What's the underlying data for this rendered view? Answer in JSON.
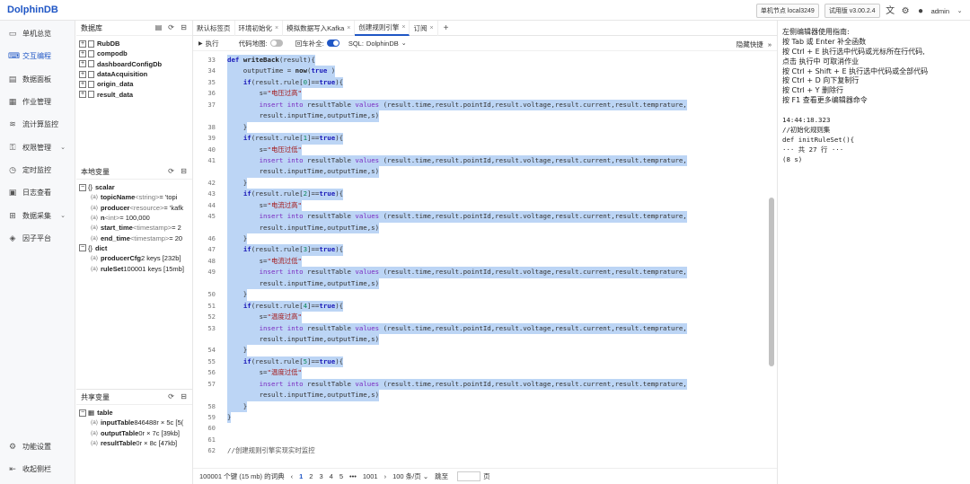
{
  "app": {
    "logo": "DolphinDB",
    "node": "单机节点 local3249",
    "version": "试用版 v3.00.2.4",
    "user": "admin"
  },
  "nav": {
    "items": [
      {
        "label": "单机总览",
        "icon": "laptop-icon"
      },
      {
        "label": "交互编程",
        "icon": "code-icon",
        "active": true
      },
      {
        "label": "数据面板",
        "icon": "dashboard-icon"
      },
      {
        "label": "作业管理",
        "icon": "job-icon"
      },
      {
        "label": "流计算监控",
        "icon": "stream-icon"
      },
      {
        "label": "权限管理",
        "icon": "lock-icon",
        "chevron": true
      },
      {
        "label": "定时监控",
        "icon": "clock-icon"
      },
      {
        "label": "日志查看",
        "icon": "log-icon"
      },
      {
        "label": "数据采集",
        "icon": "collect-icon",
        "chevron": true
      },
      {
        "label": "因子平台",
        "icon": "factor-icon"
      }
    ],
    "bottom": [
      {
        "label": "功能设置",
        "icon": "settings-icon"
      },
      {
        "label": "收起侧栏",
        "icon": "collapse-icon"
      }
    ]
  },
  "db_panel": {
    "title": "数据库",
    "items": [
      "RubDB",
      "compodb",
      "dashboardConfigDb",
      "dataAcquisition",
      "origin_data",
      "result_data"
    ]
  },
  "local_vars": {
    "title": "本地变量",
    "scalar_label": "scalar",
    "scalars": [
      {
        "name": "topicName",
        "type": "<string>",
        "value": " = 'topi"
      },
      {
        "name": "producer",
        "type": "<resource>",
        "value": " = 'kafk"
      },
      {
        "name": "n",
        "type": "<int>",
        "value": " = 100,000"
      },
      {
        "name": "start_time",
        "type": "<timestamp>",
        "value": " = 2"
      },
      {
        "name": "end_time",
        "type": "<timestamp>",
        "value": " = 20"
      }
    ],
    "dict_label": "dict",
    "dicts": [
      {
        "name": "producerCfg",
        "value": " 2 keys [232b]"
      },
      {
        "name": "ruleSet",
        "value": " 100001 keys [15mb]"
      }
    ]
  },
  "shared_vars": {
    "title": "共享变量",
    "table_label": "table",
    "tables": [
      {
        "name": "inputTable",
        "value": " 846488r × 5c [5("
      },
      {
        "name": "outputTable",
        "value": " 0r × 7c [39kb]"
      },
      {
        "name": "resultTable",
        "value": " 0r × 8c [47kb]"
      }
    ]
  },
  "tabs": [
    "默认标签页",
    "环境初始化",
    "模拟数据写入Kafka",
    "创建规则引擎",
    "订阅"
  ],
  "active_tab": 3,
  "toolbar": {
    "run": "执行",
    "code_map": "代码地图:",
    "enter_complete": "回车补全:",
    "sql_label": "SQL:",
    "sql_value": "DolphinDB",
    "hide_shortcut": "隐藏快捷"
  },
  "editor": {
    "lines": [
      {
        "n": "33",
        "hl": true,
        "tokens": [
          [
            "kw",
            "def "
          ],
          [
            "fn",
            "writeBack"
          ],
          [
            "",
            "(result){"
          ]
        ]
      },
      {
        "n": "34",
        "hl": true,
        "tokens": [
          [
            "",
            "    outputTime = "
          ],
          [
            "fn",
            "now"
          ],
          [
            "",
            "("
          ],
          [
            "kw",
            "true"
          ],
          [
            "",
            " )"
          ]
        ]
      },
      {
        "n": "35",
        "hl": true,
        "tokens": [
          [
            "",
            "    "
          ],
          [
            "kw",
            "if"
          ],
          [
            "",
            "(result.rule["
          ],
          [
            "num",
            "0"
          ],
          [
            "",
            "]=="
          ],
          [
            "kw",
            "true"
          ],
          [
            "",
            "){"
          ]
        ]
      },
      {
        "n": "36",
        "hl": true,
        "tokens": [
          [
            "",
            "        s="
          ],
          [
            "str",
            "\"电压过高\""
          ]
        ]
      },
      {
        "n": "37",
        "hl": true,
        "tokens": [
          [
            "",
            "        "
          ],
          [
            "kw2",
            "insert into"
          ],
          [
            "",
            " resultTable "
          ],
          [
            "kw2",
            "values"
          ],
          [
            "",
            " (result.time,result.pointId,result.voltage,result.current,result.temprature,"
          ]
        ]
      },
      {
        "n": "",
        "hl": true,
        "tokens": [
          [
            "",
            "        result.inputTime,outputTime,s)"
          ]
        ]
      },
      {
        "n": "38",
        "hl": true,
        "tokens": [
          [
            "",
            "    }"
          ]
        ]
      },
      {
        "n": "39",
        "hl": true,
        "tokens": [
          [
            "",
            "    "
          ],
          [
            "kw",
            "if"
          ],
          [
            "",
            "(result.rule["
          ],
          [
            "num",
            "1"
          ],
          [
            "",
            "]=="
          ],
          [
            "kw",
            "true"
          ],
          [
            "",
            "){"
          ]
        ]
      },
      {
        "n": "40",
        "hl": true,
        "tokens": [
          [
            "",
            "        s="
          ],
          [
            "str",
            "\"电压过低\""
          ]
        ]
      },
      {
        "n": "41",
        "hl": true,
        "tokens": [
          [
            "",
            "        "
          ],
          [
            "kw2",
            "insert into"
          ],
          [
            "",
            " resultTable "
          ],
          [
            "kw2",
            "values"
          ],
          [
            "",
            " (result.time,result.pointId,result.voltage,result.current,result.temprature,"
          ]
        ]
      },
      {
        "n": "",
        "hl": true,
        "tokens": [
          [
            "",
            "        result.inputTime,outputTime,s)"
          ]
        ]
      },
      {
        "n": "42",
        "hl": true,
        "tokens": [
          [
            "",
            "    }"
          ]
        ]
      },
      {
        "n": "43",
        "hl": true,
        "tokens": [
          [
            "",
            "    "
          ],
          [
            "kw",
            "if"
          ],
          [
            "",
            "(result.rule["
          ],
          [
            "num",
            "2"
          ],
          [
            "",
            "]=="
          ],
          [
            "kw",
            "true"
          ],
          [
            "",
            "){"
          ]
        ]
      },
      {
        "n": "44",
        "hl": true,
        "tokens": [
          [
            "",
            "        s="
          ],
          [
            "str",
            "\"电流过高\""
          ]
        ]
      },
      {
        "n": "45",
        "hl": true,
        "tokens": [
          [
            "",
            "        "
          ],
          [
            "kw2",
            "insert into"
          ],
          [
            "",
            " resultTable "
          ],
          [
            "kw2",
            "values"
          ],
          [
            "",
            " (result.time,result.pointId,result.voltage,result.current,result.temprature,"
          ]
        ]
      },
      {
        "n": "",
        "hl": true,
        "tokens": [
          [
            "",
            "        result.inputTime,outputTime,s)"
          ]
        ]
      },
      {
        "n": "46",
        "hl": true,
        "tokens": [
          [
            "",
            "    }"
          ]
        ]
      },
      {
        "n": "47",
        "hl": true,
        "tokens": [
          [
            "",
            "    "
          ],
          [
            "kw",
            "if"
          ],
          [
            "",
            "(result.rule["
          ],
          [
            "num",
            "3"
          ],
          [
            "",
            "]=="
          ],
          [
            "kw",
            "true"
          ],
          [
            "",
            "){"
          ]
        ]
      },
      {
        "n": "48",
        "hl": true,
        "tokens": [
          [
            "",
            "        s="
          ],
          [
            "str",
            "\"电流过低\""
          ]
        ]
      },
      {
        "n": "49",
        "hl": true,
        "tokens": [
          [
            "",
            "        "
          ],
          [
            "kw2",
            "insert into"
          ],
          [
            "",
            " resultTable "
          ],
          [
            "kw2",
            "values"
          ],
          [
            "",
            " (result.time,result.pointId,result.voltage,result.current,result.temprature,"
          ]
        ]
      },
      {
        "n": "",
        "hl": true,
        "tokens": [
          [
            "",
            "        result.inputTime,outputTime,s)"
          ]
        ]
      },
      {
        "n": "50",
        "hl": true,
        "tokens": [
          [
            "",
            "    }"
          ]
        ]
      },
      {
        "n": "51",
        "hl": true,
        "tokens": [
          [
            "",
            "    "
          ],
          [
            "kw",
            "if"
          ],
          [
            "",
            "(result.rule["
          ],
          [
            "num",
            "4"
          ],
          [
            "",
            "]=="
          ],
          [
            "kw",
            "true"
          ],
          [
            "",
            "){"
          ]
        ]
      },
      {
        "n": "52",
        "hl": true,
        "tokens": [
          [
            "",
            "        s="
          ],
          [
            "str",
            "\"温度过高\""
          ]
        ]
      },
      {
        "n": "53",
        "hl": true,
        "tokens": [
          [
            "",
            "        "
          ],
          [
            "kw2",
            "insert into"
          ],
          [
            "",
            " resultTable "
          ],
          [
            "kw2",
            "values"
          ],
          [
            "",
            " (result.time,result.pointId,result.voltage,result.current,result.temprature,"
          ]
        ]
      },
      {
        "n": "",
        "hl": true,
        "tokens": [
          [
            "",
            "        result.inputTime,outputTime,s)"
          ]
        ]
      },
      {
        "n": "54",
        "hl": true,
        "tokens": [
          [
            "",
            "    }"
          ]
        ]
      },
      {
        "n": "55",
        "hl": true,
        "tokens": [
          [
            "",
            "    "
          ],
          [
            "kw",
            "if"
          ],
          [
            "",
            "(result.rule["
          ],
          [
            "num",
            "5"
          ],
          [
            "",
            "]=="
          ],
          [
            "kw",
            "true"
          ],
          [
            "",
            "){"
          ]
        ]
      },
      {
        "n": "56",
        "hl": true,
        "tokens": [
          [
            "",
            "        s="
          ],
          [
            "str",
            "\"温度过低\""
          ]
        ]
      },
      {
        "n": "57",
        "hl": true,
        "tokens": [
          [
            "",
            "        "
          ],
          [
            "kw2",
            "insert into"
          ],
          [
            "",
            " resultTable "
          ],
          [
            "kw2",
            "values"
          ],
          [
            "",
            " (result.time,result.pointId,result.voltage,result.current,result.temprature,"
          ]
        ]
      },
      {
        "n": "",
        "hl": true,
        "tokens": [
          [
            "",
            "        result.inputTime,outputTime,s)"
          ]
        ]
      },
      {
        "n": "58",
        "hl": true,
        "tokens": [
          [
            "",
            "    }"
          ]
        ]
      },
      {
        "n": "59",
        "hl": true,
        "tokens": [
          [
            "",
            "}"
          ]
        ]
      },
      {
        "n": "60",
        "hl": false,
        "tokens": []
      },
      {
        "n": "61",
        "hl": false,
        "tokens": []
      },
      {
        "n": "62",
        "hl": false,
        "tokens": [
          [
            "cmt",
            "//创建规则引擎实现实时监控"
          ]
        ]
      }
    ]
  },
  "statusbar": {
    "dict_info": "100001 个键 (15 mb) 的词典",
    "prev": "‹",
    "pages": [
      "1",
      "2",
      "3",
      "4",
      "5",
      "•••",
      "1001"
    ],
    "next": "›",
    "per_page": "100 条/页",
    "goto": "跳至",
    "page_unit": "页"
  },
  "console": {
    "lines": [
      "左侧编辑器使用指南:",
      "按 Tab 或 Enter 补全函数",
      "按 Ctrl + E 执行选中代码或光标所在行代码,",
      "点击 执行中 可取消作业",
      "按 Ctrl + Shift + E 执行选中代码或全部代码",
      "按 Ctrl + D 向下复制行",
      "按 Ctrl + Y 删除行",
      "按 F1 查看更多编辑器命令",
      "",
      "14:44:18.323",
      "//初始化规则集",
      "def initRuleSet(){",
      "··· 共 27 行 ···",
      "(8 s)"
    ]
  }
}
